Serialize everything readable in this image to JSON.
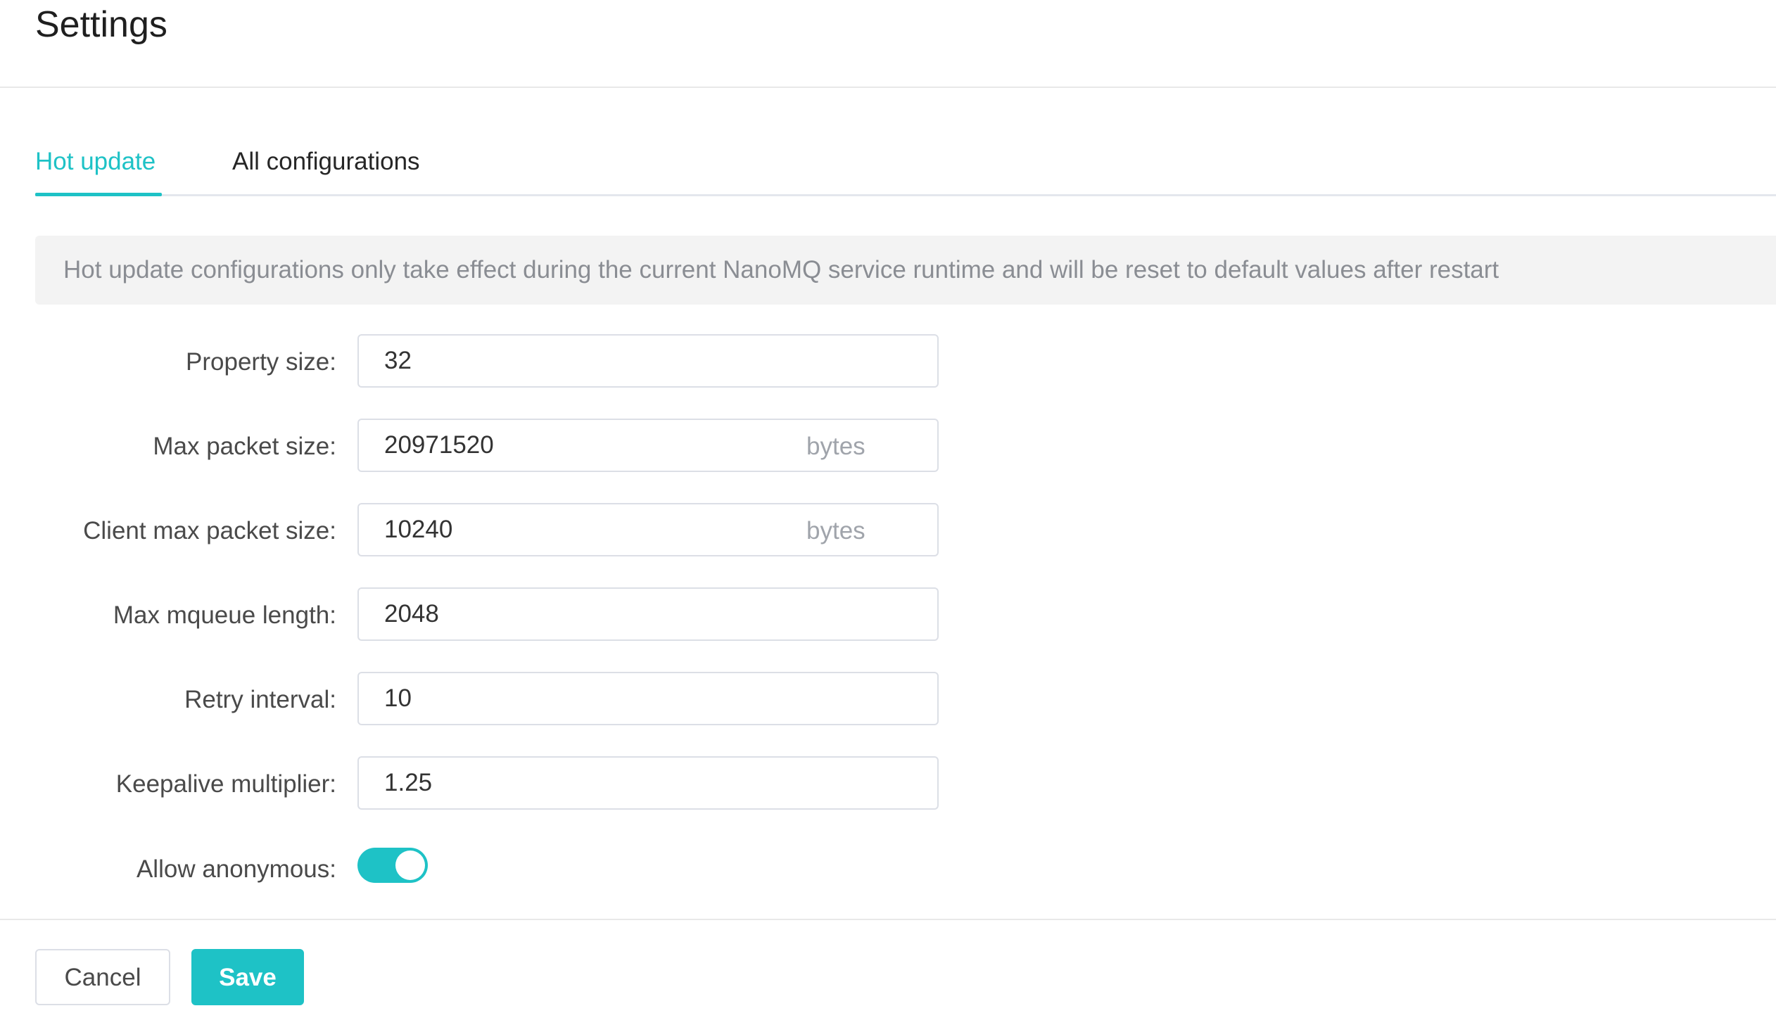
{
  "header": {
    "title": "Settings"
  },
  "tabs": [
    {
      "label": "Hot update",
      "active": true
    },
    {
      "label": "All configurations",
      "active": false
    }
  ],
  "notice": {
    "text": "Hot update configurations only take effect during the current NanoMQ service runtime and will be reset to default values after restart"
  },
  "form": {
    "property_size": {
      "label": "Property size:",
      "value": "32"
    },
    "max_packet_size": {
      "label": "Max packet size:",
      "value": "20971520",
      "unit": "bytes"
    },
    "client_max_packet_size": {
      "label": "Client max packet size:",
      "value": "10240",
      "unit": "bytes"
    },
    "max_mqueue_length": {
      "label": "Max mqueue length:",
      "value": "2048"
    },
    "retry_interval": {
      "label": "Retry interval:",
      "value": "10"
    },
    "keepalive_multiplier": {
      "label": "Keepalive multiplier:",
      "value": "1.25"
    },
    "allow_anonymous": {
      "label": "Allow anonymous:",
      "enabled": true
    }
  },
  "footer": {
    "cancel_label": "Cancel",
    "save_label": "Save"
  },
  "colors": {
    "accent": "#1ec2c6",
    "border": "#dcdfe6",
    "muted_text": "#8a8d93"
  }
}
